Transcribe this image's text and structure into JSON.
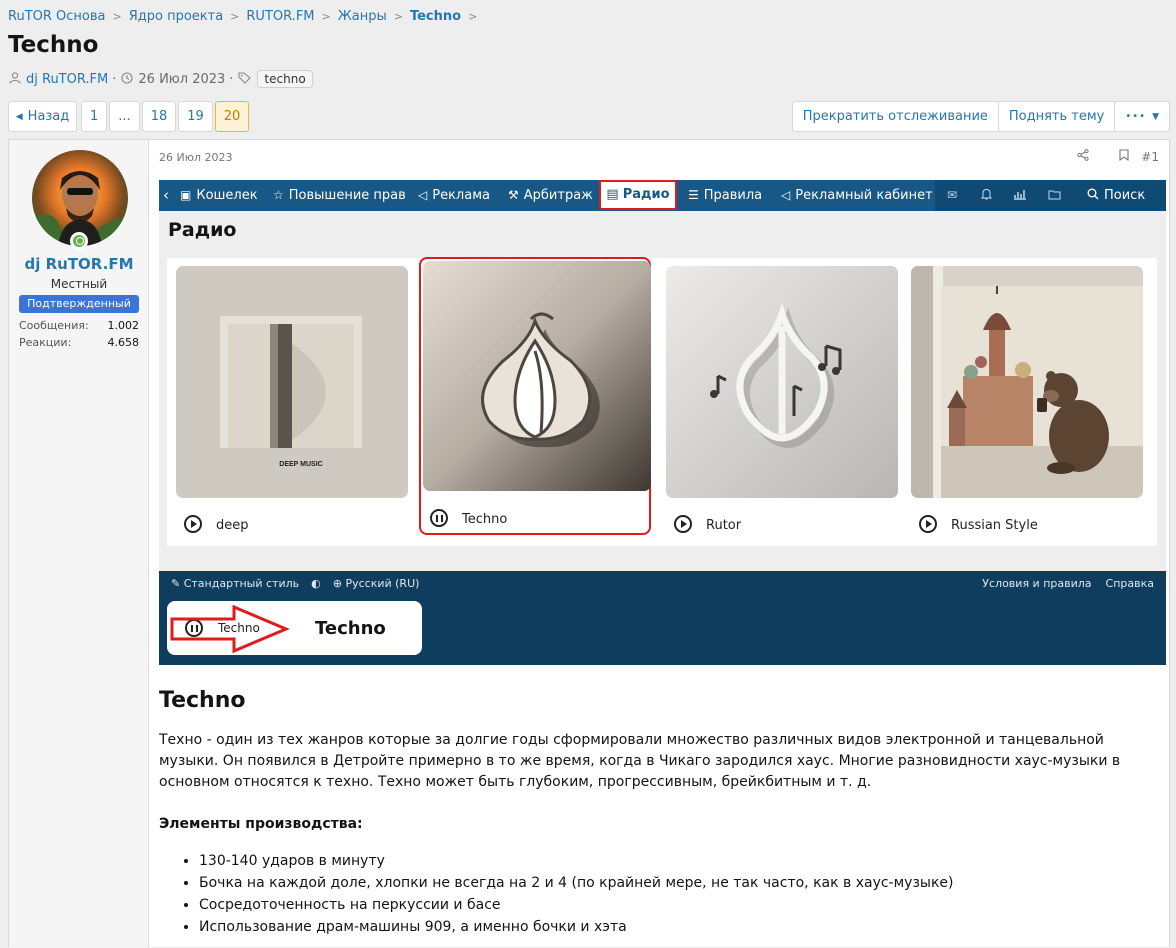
{
  "breadcrumb": [
    {
      "label": "RuTOR Основа"
    },
    {
      "label": "Ядро проекта"
    },
    {
      "label": "RUTOR.FM"
    },
    {
      "label": "Жанры"
    },
    {
      "label": "Techno"
    }
  ],
  "thread": {
    "title": "Techno",
    "author": "dj RuTOR.FM",
    "date": "26 Июл 2023",
    "tag": "techno"
  },
  "pagination": {
    "back_label": "Назад",
    "pages": [
      "1",
      "...",
      "18",
      "19",
      "20"
    ],
    "current": "20"
  },
  "thread_actions": {
    "unwatch": "Прекратить отслеживание",
    "bump": "Поднять тему",
    "more": "•••"
  },
  "post": {
    "date": "26 Июл 2023",
    "number": "#1",
    "user": {
      "name": "dj RuTOR.FM",
      "title": "Местный",
      "banner": "Подтвержденный",
      "stats": [
        {
          "key": "Сообщения:",
          "value": "1.002"
        },
        {
          "key": "Реакции:",
          "value": "4.658"
        }
      ]
    }
  },
  "screenshot": {
    "nav": [
      {
        "icon": "wallet-icon",
        "label": "Кошелек"
      },
      {
        "icon": "star-icon",
        "label": "Повышение прав"
      },
      {
        "icon": "megaphone-icon",
        "label": "Реклама"
      },
      {
        "icon": "hammer-icon",
        "label": "Арбитраж"
      },
      {
        "icon": "radio-icon",
        "label": "Радио"
      },
      {
        "icon": "list-icon",
        "label": "Правила"
      },
      {
        "icon": "megaphone-icon",
        "label": "Рекламный кабинет"
      }
    ],
    "search_label": "Поиск",
    "page_title": "Радио",
    "stations": [
      {
        "label": "deep",
        "state": "play",
        "cover_text": "DEEP MUSIC"
      },
      {
        "label": "Techno",
        "state": "pause"
      },
      {
        "label": "Rutor",
        "state": "play"
      },
      {
        "label": "Russian Style",
        "state": "play"
      }
    ],
    "footer_left": [
      "Стандартный стиль",
      "Русский (RU)"
    ],
    "footer_right": [
      "Условия и правила",
      "Справка"
    ],
    "player": {
      "label": "Techno",
      "now_playing": "Techno"
    }
  },
  "article": {
    "heading": "Techno",
    "paragraph": "Техно - один из тех жанров которые за долгие годы сформировали множество различных видов электронной и танцевальной музыки. Он появился в Детройте примерно в то же время, когда в Чикаго зародился хаус. Многие разновидности хаус-музыки в основном относятся к техно. Техно может быть глубоким, прогрессивным, брейкбитным и т. д.",
    "subheading": "Элементы производства:",
    "items": [
      "130-140 ударов в минуту",
      "Бочка на каждой доле, хлопки не всегда на 2 и 4 (по крайней мере, не так часто, как в хаус-музыке)",
      "Сосредоточенность на перкуссии и басе",
      "Использование драм-машины 909, а именно бочки и хэта"
    ]
  },
  "colors": {
    "link": "#2577b1",
    "nav_bg": "#185886",
    "footer_bg": "#0e3d5e",
    "highlight_red": "#e01b1b",
    "banner_blue": "#3a74d4",
    "online_green": "#63b34b"
  }
}
